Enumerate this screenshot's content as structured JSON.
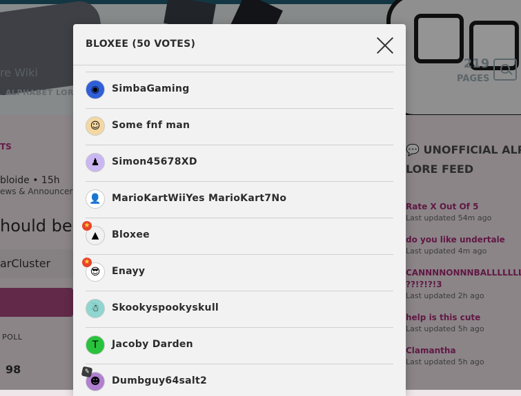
{
  "background": {
    "wiki_name": "re Wiki",
    "nav_label": "ALPHABET LORE",
    "pages": {
      "count": "219",
      "label": "PAGES"
    },
    "left_section_label": "TS",
    "author": "bloide",
    "post_time": "15h",
    "category": "ews & Announcer",
    "post_title": "hould be",
    "option_1": "arCluster",
    "poll_label": "POLL",
    "poll_count": "98",
    "sidebar": {
      "heading_line1": "UNOFFICIAL ALP",
      "heading_line2": "LORE FEED",
      "feed": [
        {
          "title": "Rate X Out Of 5",
          "time": "Last updated 54m ago"
        },
        {
          "title": "do you like undertale",
          "time": "Last updated 4m ago"
        },
        {
          "title": "CANNNNONNNBALLLLLLLL?",
          "title2": "??!?!?!3",
          "time": "Last updated 2h ago"
        },
        {
          "title": "help is this cute",
          "time": "Last updated 5h ago"
        },
        {
          "title": "Clamantha",
          "time": "Last updated 5h ago"
        }
      ]
    }
  },
  "modal": {
    "title": "BLOXEE (50 VOTES)",
    "voters": [
      {
        "name": "SimbaGaming",
        "avatar_icon": "blue-circle-face-icon",
        "avatar_color": "#2f5ed8",
        "glyph": "◉",
        "badge": ""
      },
      {
        "name": "Some fnf man",
        "avatar_icon": "cartoon-character-icon",
        "avatar_color": "#f4d7a1",
        "glyph": "☺",
        "badge": ""
      },
      {
        "name": "Simon45678XD",
        "avatar_icon": "purple-character-icon",
        "avatar_color": "#c9b6f2",
        "glyph": "♟",
        "badge": ""
      },
      {
        "name": "MarioKartWiiYes MarioKart7No",
        "avatar_icon": "default-user-icon",
        "avatar_color": "#ffffff",
        "glyph": "👤",
        "badge": ""
      },
      {
        "name": "Bloxee",
        "avatar_icon": "triangle-character-icon",
        "avatar_color": "#f1f1f1",
        "glyph": "▲",
        "badge": "★"
      },
      {
        "name": "Enayy",
        "avatar_icon": "sunglasses-face-icon",
        "avatar_color": "#ffffff",
        "glyph": "😎",
        "badge": "★"
      },
      {
        "name": "Skookyspookyskull",
        "avatar_icon": "teal-character-icon",
        "avatar_color": "#8ed6cf",
        "glyph": "☃",
        "badge": ""
      },
      {
        "name": "Jacoby Darden",
        "avatar_icon": "green-logo-icon",
        "avatar_color": "#29c23c",
        "glyph": "T",
        "badge": ""
      },
      {
        "name": "Dumbguy64salt2",
        "avatar_icon": "purple-face-icon",
        "avatar_color": "#b07fd0",
        "glyph": "☻",
        "badge": "✎"
      }
    ]
  }
}
